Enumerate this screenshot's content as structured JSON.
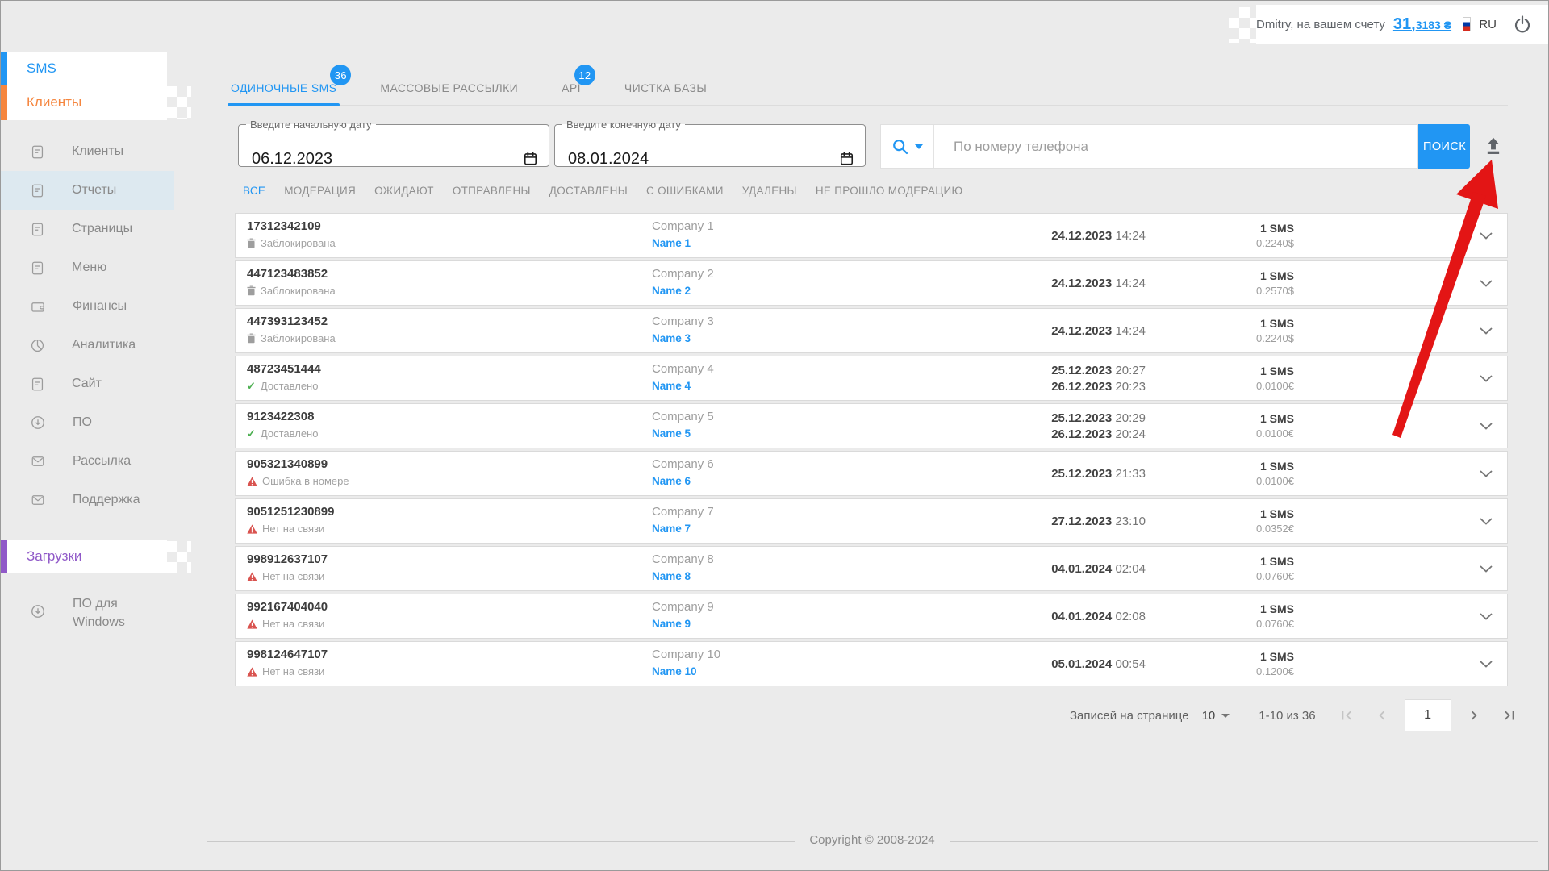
{
  "topbar": {
    "user_prefix": "Dmitry, на вашем счету",
    "balance_main": "31,",
    "balance_frac": "3183 ₴",
    "lang": "RU"
  },
  "sidebar": {
    "section_sms": "SMS",
    "section_clients": "Клиенты",
    "section_downloads": "Загрузки",
    "items": [
      {
        "label": "Клиенты",
        "icon": "document-icon",
        "selected": false
      },
      {
        "label": "Отчеты",
        "icon": "document-icon",
        "selected": true
      },
      {
        "label": "Страницы",
        "icon": "document-icon",
        "selected": false
      },
      {
        "label": "Меню",
        "icon": "document-icon",
        "selected": false
      },
      {
        "label": "Финансы",
        "icon": "wallet-icon",
        "selected": false
      },
      {
        "label": "Аналитика",
        "icon": "pie-chart-icon",
        "selected": false
      },
      {
        "label": "Сайт",
        "icon": "document-icon",
        "selected": false
      },
      {
        "label": "ПО",
        "icon": "download-icon",
        "selected": false
      },
      {
        "label": "Рассылка",
        "icon": "envelope-icon",
        "selected": false
      },
      {
        "label": "Поддержка",
        "icon": "envelope-icon",
        "selected": false
      }
    ],
    "downloads_item": {
      "line1": "ПО для",
      "line2": "Windows",
      "icon": "download-icon"
    }
  },
  "tabs": [
    {
      "label": "ОДИНОЧНЫЕ SMS",
      "badge": "36",
      "active": true
    },
    {
      "label": "МАССОВЫЕ РАССЫЛКИ",
      "badge": "",
      "active": false
    },
    {
      "label": "API",
      "badge": "12",
      "active": false
    },
    {
      "label": "ЧИСТКА БАЗЫ",
      "badge": "",
      "active": false
    }
  ],
  "search": {
    "date_from_label": "Введите начальную дату",
    "date_from_value": "06.12.2023",
    "date_to_label": "Введите конечную дату",
    "date_to_value": "08.01.2024",
    "placeholder": "По номеру телефона",
    "button": "ПОИСК"
  },
  "status_tabs": [
    {
      "label": "ВСЕ",
      "active": true
    },
    {
      "label": "МОДЕРАЦИЯ",
      "active": false
    },
    {
      "label": "ОЖИДАЮТ",
      "active": false
    },
    {
      "label": "ОТПРАВЛЕНЫ",
      "active": false
    },
    {
      "label": "ДОСТАВЛЕНЫ",
      "active": false
    },
    {
      "label": "С ОШИБКАМИ",
      "active": false
    },
    {
      "label": "УДАЛЕНЫ",
      "active": false
    },
    {
      "label": "НЕ ПРОШЛО МОДЕРАЦИЮ",
      "active": false
    }
  ],
  "rows": [
    {
      "phone": "17312342109",
      "status": "Заблокирована",
      "status_type": "blocked",
      "company": "Company 1",
      "name": "Name 1",
      "dates": [
        {
          "date": "24.12.2023",
          "time": "14:24"
        }
      ],
      "sms": "1 SMS",
      "cost": "0.2240$"
    },
    {
      "phone": "447123483852",
      "status": "Заблокирована",
      "status_type": "blocked",
      "company": "Company 2",
      "name": "Name 2",
      "dates": [
        {
          "date": "24.12.2023",
          "time": "14:24"
        }
      ],
      "sms": "1 SMS",
      "cost": "0.2570$"
    },
    {
      "phone": "447393123452",
      "status": "Заблокирована",
      "status_type": "blocked",
      "company": "Company 3",
      "name": "Name 3",
      "dates": [
        {
          "date": "24.12.2023",
          "time": "14:24"
        }
      ],
      "sms": "1 SMS",
      "cost": "0.2240$"
    },
    {
      "phone": "48723451444",
      "status": "Доставлено",
      "status_type": "delivered",
      "company": "Company 4",
      "name": "Name 4",
      "dates": [
        {
          "date": "25.12.2023",
          "time": "20:27"
        },
        {
          "date": "26.12.2023",
          "time": "20:23"
        }
      ],
      "sms": "1 SMS",
      "cost": "0.0100€"
    },
    {
      "phone": "9123422308",
      "status": "Доставлено",
      "status_type": "delivered",
      "company": "Company 5",
      "name": "Name 5",
      "dates": [
        {
          "date": "25.12.2023",
          "time": "20:29"
        },
        {
          "date": "26.12.2023",
          "time": "20:24"
        }
      ],
      "sms": "1 SMS",
      "cost": "0.0100€"
    },
    {
      "phone": "905321340899",
      "status": "Ошибка в номере",
      "status_type": "error",
      "company": "Company 6",
      "name": "Name 6",
      "dates": [
        {
          "date": "25.12.2023",
          "time": "21:33"
        }
      ],
      "sms": "1 SMS",
      "cost": "0.0100€"
    },
    {
      "phone": "9051251230899",
      "status": "Нет на связи",
      "status_type": "error",
      "company": "Company 7",
      "name": "Name 7",
      "dates": [
        {
          "date": "27.12.2023",
          "time": "23:10"
        }
      ],
      "sms": "1 SMS",
      "cost": "0.0352€"
    },
    {
      "phone": "998912637107",
      "status": "Нет на связи",
      "status_type": "error",
      "company": "Company 8",
      "name": "Name 8",
      "dates": [
        {
          "date": "04.01.2024",
          "time": "02:04"
        }
      ],
      "sms": "1 SMS",
      "cost": "0.0760€"
    },
    {
      "phone": "992167404040",
      "status": "Нет на связи",
      "status_type": "error",
      "company": "Company 9",
      "name": "Name 9",
      "dates": [
        {
          "date": "04.01.2024",
          "time": "02:08"
        }
      ],
      "sms": "1 SMS",
      "cost": "0.0760€"
    },
    {
      "phone": "998124647107",
      "status": "Нет на связи",
      "status_type": "error",
      "company": "Company 10",
      "name": "Name 10",
      "dates": [
        {
          "date": "05.01.2024",
          "time": "00:54"
        }
      ],
      "sms": "1 SMS",
      "cost": "0.1200€"
    }
  ],
  "pagination": {
    "per_page_label": "Записей на странице",
    "per_page": "10",
    "range": "1-10 из 36",
    "current_page": "1"
  },
  "footer": {
    "copyright": "Copyright © 2008-2024"
  },
  "colors": {
    "accent": "#2196f3",
    "clients_orange": "#f5863f",
    "downloads_purple": "#9059c8",
    "success_green": "#4caf50",
    "error_red": "#d9534f",
    "arrow_red": "#e31515",
    "search_button_blue": "#2196f3"
  }
}
